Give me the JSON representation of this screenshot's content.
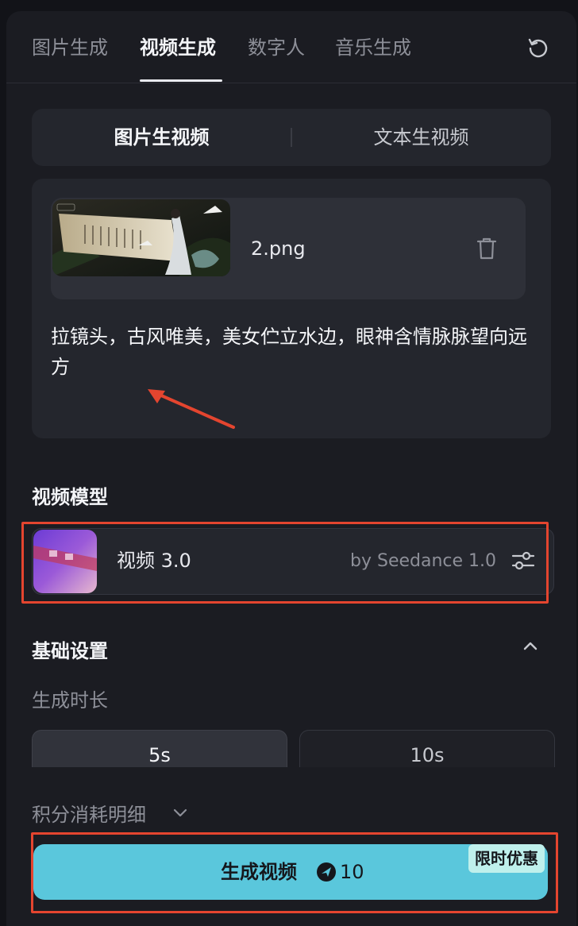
{
  "tabs": [
    {
      "label": "图片生成"
    },
    {
      "label": "视频生成"
    },
    {
      "label": "数字人"
    },
    {
      "label": "音乐生成"
    }
  ],
  "mode": {
    "options": [
      "图片生视频",
      "文本生视频"
    ],
    "selected": "图片生视频"
  },
  "upload": {
    "file_name": "2.png",
    "prompt": "拉镜头，古风唯美，美女伫立水边，眼神含情脉脉望向远方"
  },
  "model_section": {
    "title": "视频模型",
    "model_name": "视频 3.0",
    "model_by": "by Seedance 1.0"
  },
  "basic_settings": {
    "title": "基础设置",
    "duration_label": "生成时长",
    "durations": [
      "5s",
      "10s"
    ],
    "selected_duration": "5s"
  },
  "cost": {
    "label": "积分消耗明细"
  },
  "generate": {
    "label": "生成视频",
    "credits": "10",
    "promo_badge": "限时优惠"
  },
  "colors": {
    "accent": "#5ac7dc",
    "highlight": "#e4452f",
    "background": "#1b1c22"
  }
}
